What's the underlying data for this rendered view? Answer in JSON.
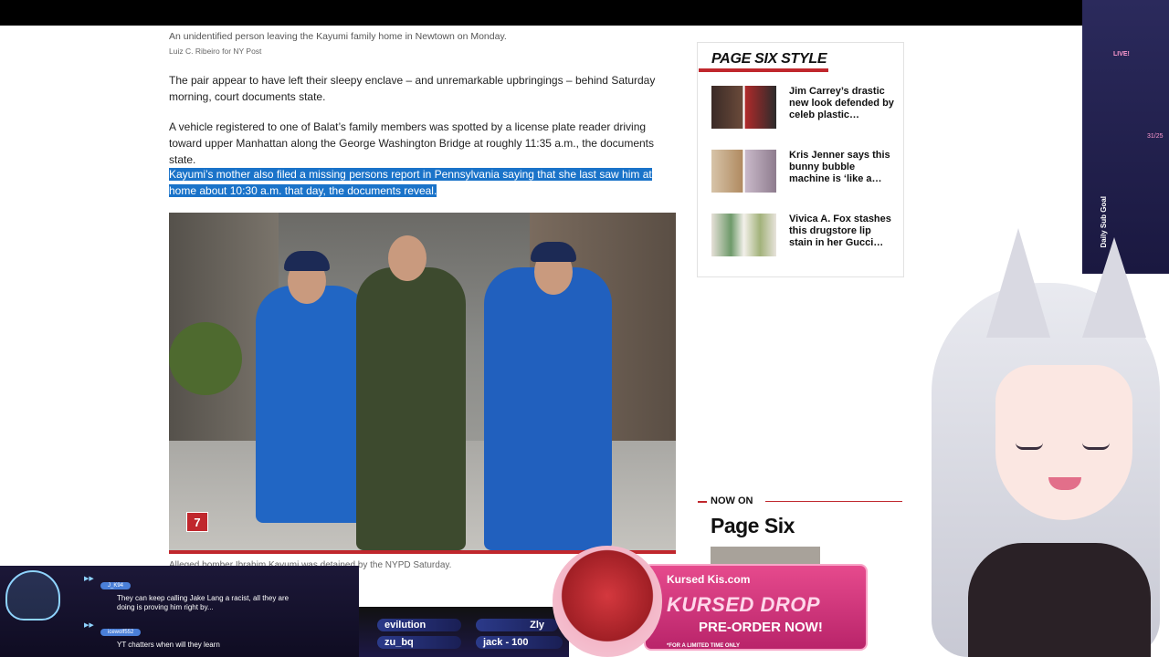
{
  "article": {
    "caption": "An unidentified person leaving the Kayumi family home in Newtown on Monday.",
    "credit": "Luiz C. Ribeiro for NY Post",
    "paragraphs": [
      "The pair appear to have left their sleepy enclave – and unremarkable upbringings – behind Saturday morning, court documents state.",
      "A vehicle registered to one of Balat’s family members was spotted by a license plate reader driving toward upper Manhattan along the George Washington Bridge at roughly 11:35 a.m., the documents state.",
      "Kayumi’s mother also filed a missing persons report in Pennsylvania saying that she last saw him at home about 10:30 a.m. that day, the documents reveal."
    ],
    "photo_logo": "7",
    "photo_caption": "Alleged bomber Ibrahim Kayumi was detained by the NYPD Saturday."
  },
  "sidebar": {
    "title": "PAGE SIX STYLE",
    "stories": [
      {
        "headline": "Jim Carrey’s drastic new look defended by celeb plastic…"
      },
      {
        "headline": "Kris Jenner says this bunny bubble machine is ‘like a…"
      },
      {
        "headline": "Vivica A. Fox stashes this drugstore lip stain in her Gucci…"
      }
    ]
  },
  "now_on": {
    "label": "NOW ON",
    "brand": "Page Six"
  },
  "stream": {
    "chat": [
      {
        "user": "J_K94",
        "text": "They can keep calling Jake Lang a racist, all they are doing is proving him right by..."
      },
      {
        "user": "icewolf552",
        "text": "YT chatters when will they learn"
      }
    ],
    "subs": [
      "evilution",
      "Zly",
      "zu_bq",
      "jack - 100"
    ],
    "drop": {
      "brand": "Kursed Kis.com",
      "title": "KURSED DROP",
      "cta": "PRE-ORDER NOW!",
      "fine_print": "*FOR A LIMITED TIME ONLY"
    },
    "live_label": "LIVE!",
    "sub_goal_label": "Daily Sub Goal",
    "sub_goal_count": "31/25"
  }
}
